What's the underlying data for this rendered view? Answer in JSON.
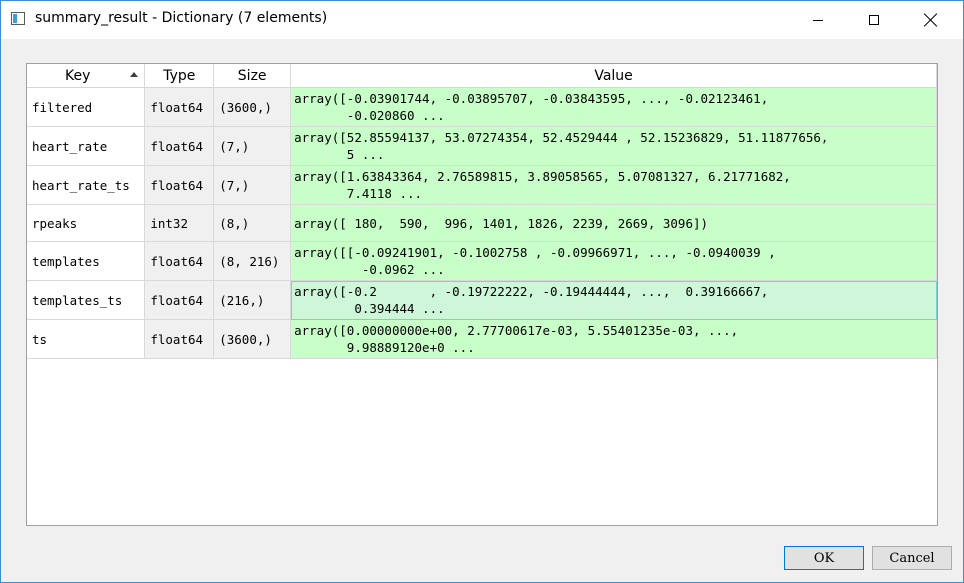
{
  "window": {
    "title": "summary_result - Dictionary (7 elements)"
  },
  "table": {
    "columns": [
      "Key",
      "Type",
      "Size",
      "Value"
    ],
    "rows": [
      {
        "key": "filtered",
        "type": "float64",
        "size": "(3600,)",
        "value": "array([-0.03901744, -0.03895707, -0.03843595, ..., -0.02123461,\n       -0.020860 ..."
      },
      {
        "key": "heart_rate",
        "type": "float64",
        "size": "(7,)",
        "value": "array([52.85594137, 53.07274354, 52.4529444 , 52.15236829, 51.11877656,\n       5 ..."
      },
      {
        "key": "heart_rate_ts",
        "type": "float64",
        "size": "(7,)",
        "value": "array([1.63843364, 2.76589815, 3.89058565, 5.07081327, 6.21771682,\n       7.4118 ..."
      },
      {
        "key": "rpeaks",
        "type": "int32",
        "size": "(8,)",
        "value": "array([ 180,  590,  996, 1401, 1826, 2239, 2669, 3096])"
      },
      {
        "key": "templates",
        "type": "float64",
        "size": "(8, 216)",
        "value": "array([[-0.09241901, -0.1002758 , -0.09966971, ..., -0.0940039 ,\n         -0.0962 ..."
      },
      {
        "key": "templates_ts",
        "type": "float64",
        "size": "(216,)",
        "value": "array([-0.2       , -0.19722222, -0.19444444, ...,  0.39166667,\n        0.394444 ..."
      },
      {
        "key": "ts",
        "type": "float64",
        "size": "(3600,)",
        "value": "array([0.00000000e+00, 2.77700617e-03, 5.55401235e-03, ...,\n       9.98889120e+0 ..."
      }
    ]
  },
  "buttons": {
    "ok": "OK",
    "cancel": "Cancel"
  }
}
